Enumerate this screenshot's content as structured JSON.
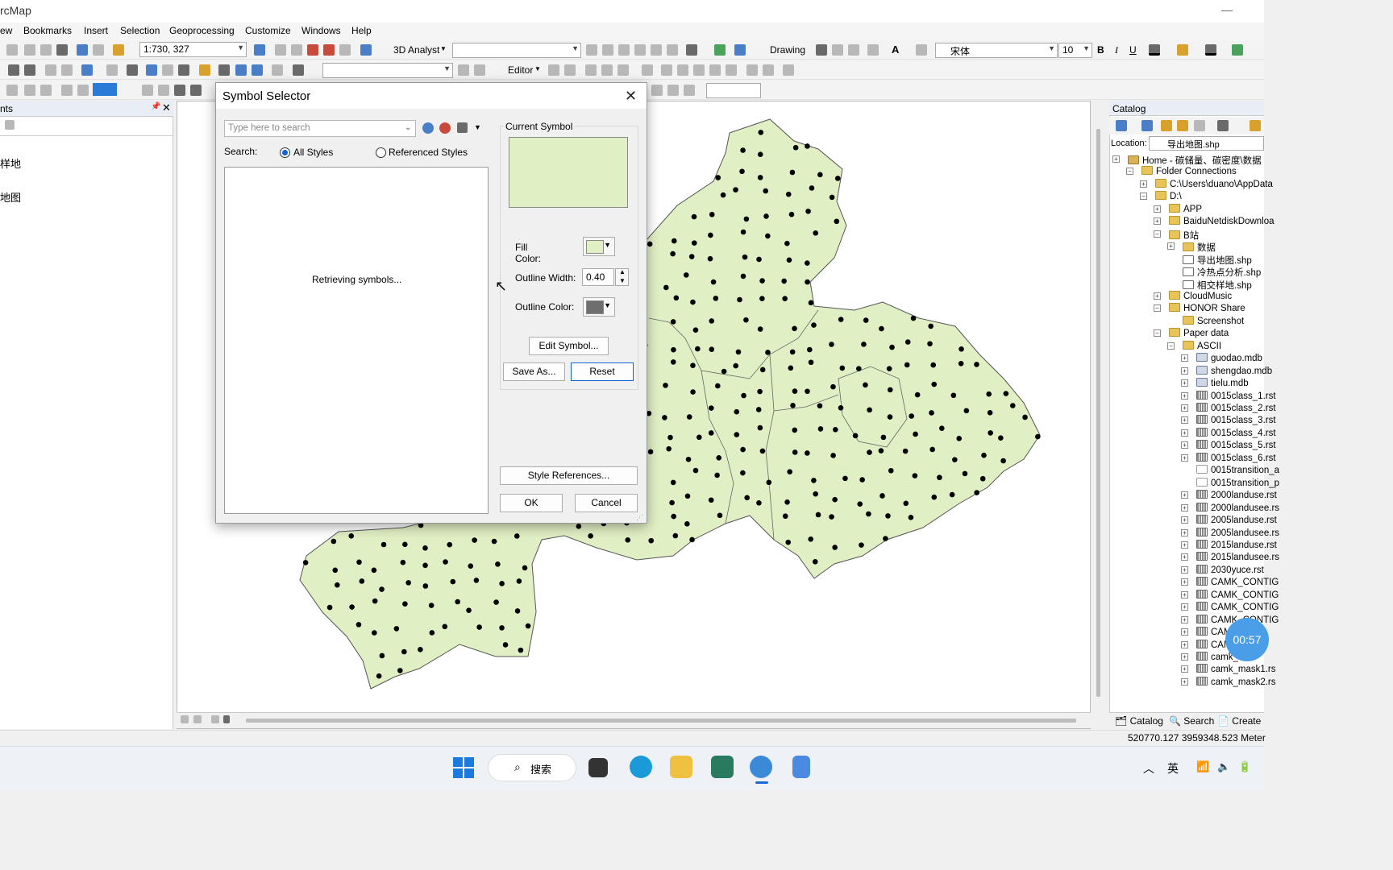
{
  "app": {
    "title": "rcMap"
  },
  "menu": [
    "ew",
    "Bookmarks",
    "Insert",
    "Selection",
    "Geoprocessing",
    "Customize",
    "Windows",
    "Help"
  ],
  "toolbar": {
    "scale": "1:730, 327",
    "analyst": "3D Analyst",
    "drawing": "Drawing",
    "font": "宋体",
    "font_size": "10",
    "editor": "Editor",
    "bold": "B",
    "italic": "I",
    "underline": "U"
  },
  "toc": {
    "title": "nts",
    "items": [
      "样地",
      "地图"
    ]
  },
  "dialog": {
    "title": "Symbol Selector",
    "search_placeholder": "Type here to search",
    "search_label": "Search:",
    "radio_all": "All Styles",
    "radio_ref": "Referenced Styles",
    "retrieving": "Retrieving symbols...",
    "current_symbol": "Current Symbol",
    "fill_color_1": "Fill",
    "fill_color_2": "Color:",
    "outline_width_label": "Outline Width:",
    "outline_width_value": "0.40",
    "outline_color_label": "Outline Color:",
    "edit_symbol": "Edit Symbol...",
    "save_as": "Save As...",
    "reset": "Reset",
    "style_references": "Style References...",
    "ok": "OK",
    "cancel": "Cancel",
    "fill_color_hex": "#e1efc4",
    "outline_color_hex": "#6e6e6e"
  },
  "catalog": {
    "title": "Catalog",
    "location_label": "Location:",
    "location_value": "导出地图.shp",
    "tree": [
      {
        "label": "Home - 碳储量、碳密度\\数据",
        "icon": "home",
        "exp": "+"
      },
      {
        "label": "Folder Connections",
        "icon": "folder",
        "exp": "-"
      },
      {
        "label": "C:\\Users\\duano\\AppData",
        "icon": "folder",
        "exp": "+"
      },
      {
        "label": "D:\\",
        "icon": "folder",
        "exp": "-"
      },
      {
        "label": "APP",
        "icon": "folder",
        "exp": "+"
      },
      {
        "label": "BaiduNetdiskDownloa",
        "icon": "folder",
        "exp": "+"
      },
      {
        "label": "B站",
        "icon": "folder",
        "exp": "-"
      },
      {
        "label": "数据",
        "icon": "folder",
        "exp": "+"
      },
      {
        "label": "导出地图.shp",
        "icon": "shp",
        "exp": ""
      },
      {
        "label": "冷热点分析.shp",
        "icon": "shp",
        "exp": ""
      },
      {
        "label": "相交样地.shp",
        "icon": "shp",
        "exp": ""
      },
      {
        "label": "CloudMusic",
        "icon": "folder",
        "exp": "+"
      },
      {
        "label": "HONOR Share",
        "icon": "folder",
        "exp": "-"
      },
      {
        "label": "Screenshot",
        "icon": "folder",
        "exp": ""
      },
      {
        "label": "Paper data",
        "icon": "folder",
        "exp": "-"
      },
      {
        "label": "ASCII",
        "icon": "folder",
        "exp": "-"
      },
      {
        "label": "guodao.mdb",
        "icon": "db",
        "exp": "+"
      },
      {
        "label": "shengdao.mdb",
        "icon": "db",
        "exp": "+"
      },
      {
        "label": "tielu.mdb",
        "icon": "db",
        "exp": "+"
      },
      {
        "label": "0015class_1.rst",
        "icon": "raster",
        "exp": "+"
      },
      {
        "label": "0015class_2.rst",
        "icon": "raster",
        "exp": "+"
      },
      {
        "label": "0015class_3.rst",
        "icon": "raster",
        "exp": "+"
      },
      {
        "label": "0015class_4.rst",
        "icon": "raster",
        "exp": "+"
      },
      {
        "label": "0015class_5.rst",
        "icon": "raster",
        "exp": "+"
      },
      {
        "label": "0015class_6.rst",
        "icon": "raster",
        "exp": "+"
      },
      {
        "label": "0015transition_a",
        "icon": "file",
        "exp": ""
      },
      {
        "label": "0015transition_p",
        "icon": "file",
        "exp": ""
      },
      {
        "label": "2000landuse.rst",
        "icon": "raster",
        "exp": "+"
      },
      {
        "label": "2000landusee.rs",
        "icon": "raster",
        "exp": "+"
      },
      {
        "label": "2005landuse.rst",
        "icon": "raster",
        "exp": "+"
      },
      {
        "label": "2005landusee.rs",
        "icon": "raster",
        "exp": "+"
      },
      {
        "label": "2015landuse.rst",
        "icon": "raster",
        "exp": "+"
      },
      {
        "label": "2015landusee.rs",
        "icon": "raster",
        "exp": "+"
      },
      {
        "label": "2030yuce.rst",
        "icon": "raster",
        "exp": "+"
      },
      {
        "label": "CAMK_CONTIG",
        "icon": "raster",
        "exp": "+"
      },
      {
        "label": "CAMK_CONTIG",
        "icon": "raster",
        "exp": "+"
      },
      {
        "label": "CAMK_CONTIG",
        "icon": "raster",
        "exp": "+"
      },
      {
        "label": "CAMK_CONTIG",
        "icon": "raster",
        "exp": "+"
      },
      {
        "label": "CAMK",
        "icon": "raster",
        "exp": "+"
      },
      {
        "label": "CAMK",
        "icon": "raster",
        "exp": "+"
      },
      {
        "label": "camk_m",
        "icon": "raster",
        "exp": "+"
      },
      {
        "label": "camk_mask1.rs",
        "icon": "raster",
        "exp": "+"
      },
      {
        "label": "camk_mask2.rs",
        "icon": "raster",
        "exp": "+"
      }
    ],
    "tabs": [
      "Catalog",
      "Search",
      "Create"
    ],
    "timer": "00:57"
  },
  "status": {
    "coords": "520770.127  3959348.523 Meter"
  },
  "taskbar": {
    "search": "搜索",
    "ime": "英"
  }
}
